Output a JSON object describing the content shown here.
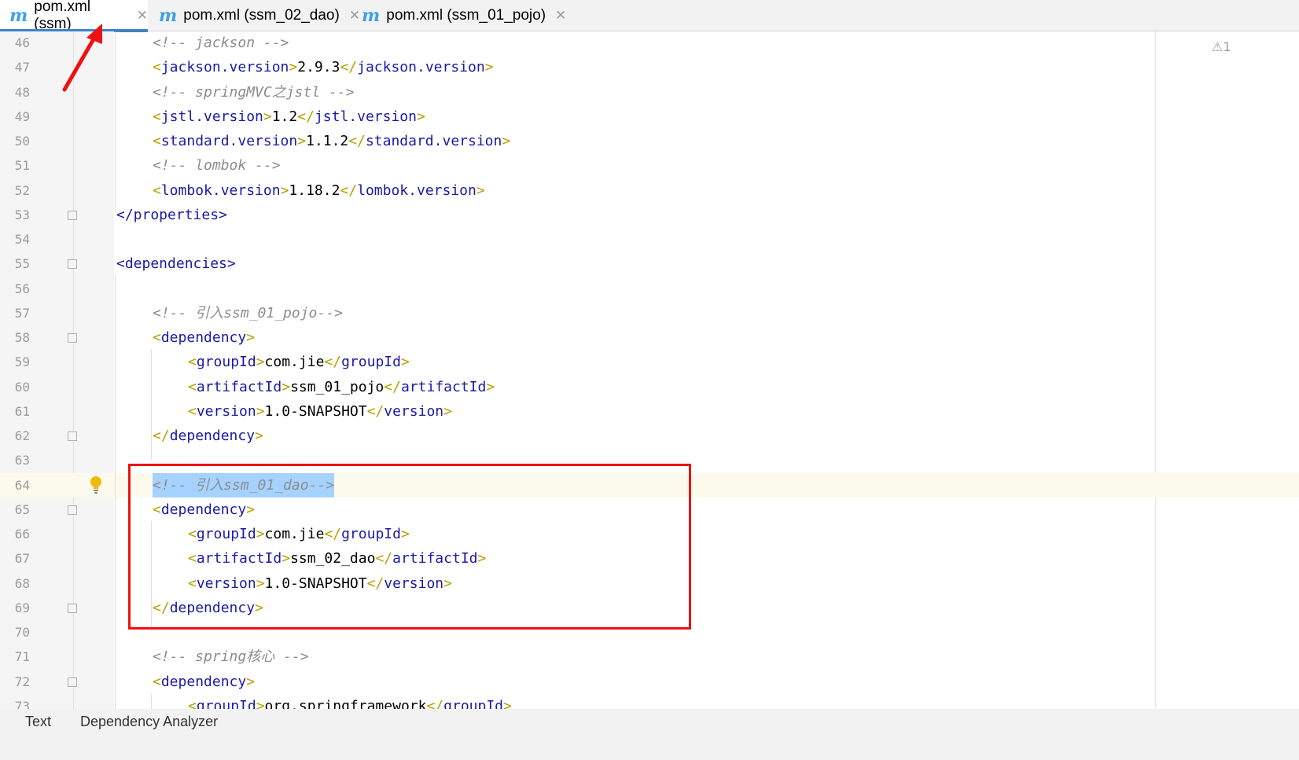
{
  "tabs": [
    {
      "label": "pom.xml (ssm)",
      "icon": "maven-m-icon",
      "active": true
    },
    {
      "label": "pom.xml (ssm_02_dao)",
      "icon": "maven-m-icon",
      "active": false
    },
    {
      "label": "pom.xml (ssm_01_pojo)",
      "icon": "maven-m-icon",
      "active": false
    }
  ],
  "tab_icon_glyph": "m",
  "tab_close_glyph": "✕",
  "warning_indicator": "⚠1",
  "bottom_tabs": [
    "Text",
    "Dependency Analyzer"
  ],
  "lines": [
    {
      "n": "46",
      "indent": 2,
      "parts": [
        [
          "cm",
          "<!-- jackson -->"
        ]
      ]
    },
    {
      "n": "47",
      "indent": 2,
      "parts": [
        [
          "br",
          "<"
        ],
        [
          "tg",
          "jackson.version"
        ],
        [
          "br",
          ">"
        ],
        [
          "tx",
          "2.9.3"
        ],
        [
          "br",
          "</"
        ],
        [
          "tg",
          "jackson.version"
        ],
        [
          "br",
          ">"
        ]
      ]
    },
    {
      "n": "48",
      "indent": 2,
      "parts": [
        [
          "cm",
          "<!-- springMVC之jstl -->"
        ]
      ]
    },
    {
      "n": "49",
      "indent": 2,
      "parts": [
        [
          "br",
          "<"
        ],
        [
          "tg",
          "jstl.version"
        ],
        [
          "br",
          ">"
        ],
        [
          "tx",
          "1.2"
        ],
        [
          "br",
          "</"
        ],
        [
          "tg",
          "jstl.version"
        ],
        [
          "br",
          ">"
        ]
      ]
    },
    {
      "n": "50",
      "indent": 2,
      "parts": [
        [
          "br",
          "<"
        ],
        [
          "tg",
          "standard.version"
        ],
        [
          "br",
          ">"
        ],
        [
          "tx",
          "1.1.2"
        ],
        [
          "br",
          "</"
        ],
        [
          "tg",
          "standard.version"
        ],
        [
          "br",
          ">"
        ]
      ]
    },
    {
      "n": "51",
      "indent": 2,
      "parts": [
        [
          "cm",
          "<!-- lombok -->"
        ]
      ]
    },
    {
      "n": "52",
      "indent": 2,
      "parts": [
        [
          "br",
          "<"
        ],
        [
          "tg",
          "lombok.version"
        ],
        [
          "br",
          ">"
        ],
        [
          "tx",
          "1.18.2"
        ],
        [
          "br",
          "</"
        ],
        [
          "tg",
          "lombok.version"
        ],
        [
          "br",
          ">"
        ]
      ]
    },
    {
      "n": "53",
      "indent": 1,
      "fold": true,
      "parts": [
        [
          "tg",
          "</properties>"
        ]
      ]
    },
    {
      "n": "54",
      "indent": 1,
      "parts": []
    },
    {
      "n": "55",
      "indent": 1,
      "fold": true,
      "parts": [
        [
          "tg",
          "<dependencies>"
        ]
      ]
    },
    {
      "n": "56",
      "indent": 1,
      "parts": []
    },
    {
      "n": "57",
      "indent": 2,
      "parts": [
        [
          "cm",
          "<!-- 引入ssm_01_pojo-->"
        ]
      ]
    },
    {
      "n": "58",
      "indent": 2,
      "fold": true,
      "parts": [
        [
          "br",
          "<"
        ],
        [
          "tg",
          "dependency"
        ],
        [
          "br",
          ">"
        ]
      ]
    },
    {
      "n": "59",
      "indent": 3,
      "parts": [
        [
          "br",
          "<"
        ],
        [
          "tg",
          "groupId"
        ],
        [
          "br",
          ">"
        ],
        [
          "tx",
          "com.jie"
        ],
        [
          "br",
          "</"
        ],
        [
          "tg",
          "groupId"
        ],
        [
          "br",
          ">"
        ]
      ]
    },
    {
      "n": "60",
      "indent": 3,
      "parts": [
        [
          "br",
          "<"
        ],
        [
          "tg",
          "artifactId"
        ],
        [
          "br",
          ">"
        ],
        [
          "tx",
          "ssm_01_pojo"
        ],
        [
          "br",
          "</"
        ],
        [
          "tg",
          "artifactId"
        ],
        [
          "br",
          ">"
        ]
      ]
    },
    {
      "n": "61",
      "indent": 3,
      "parts": [
        [
          "br",
          "<"
        ],
        [
          "tg",
          "version"
        ],
        [
          "br",
          ">"
        ],
        [
          "tx",
          "1.0-SNAPSHOT"
        ],
        [
          "br",
          "</"
        ],
        [
          "tg",
          "version"
        ],
        [
          "br",
          ">"
        ]
      ]
    },
    {
      "n": "62",
      "indent": 2,
      "fold": true,
      "parts": [
        [
          "br",
          "</"
        ],
        [
          "tg",
          "dependency"
        ],
        [
          "br",
          ">"
        ]
      ]
    },
    {
      "n": "63",
      "indent": 1,
      "parts": []
    },
    {
      "n": "64",
      "indent": 2,
      "caret": true,
      "bulb": true,
      "selected": true,
      "parts": [
        [
          "cm",
          "<!-- 引入ssm_01_dao-->"
        ]
      ]
    },
    {
      "n": "65",
      "indent": 2,
      "fold": true,
      "parts": [
        [
          "br",
          "<"
        ],
        [
          "tg",
          "dependency"
        ],
        [
          "br",
          ">"
        ]
      ]
    },
    {
      "n": "66",
      "indent": 3,
      "parts": [
        [
          "br",
          "<"
        ],
        [
          "tg",
          "groupId"
        ],
        [
          "br",
          ">"
        ],
        [
          "tx",
          "com.jie"
        ],
        [
          "br",
          "</"
        ],
        [
          "tg",
          "groupId"
        ],
        [
          "br",
          ">"
        ]
      ]
    },
    {
      "n": "67",
      "indent": 3,
      "parts": [
        [
          "br",
          "<"
        ],
        [
          "tg",
          "artifactId"
        ],
        [
          "br",
          ">"
        ],
        [
          "tx",
          "ssm_02_dao"
        ],
        [
          "br",
          "</"
        ],
        [
          "tg",
          "artifactId"
        ],
        [
          "br",
          ">"
        ]
      ]
    },
    {
      "n": "68",
      "indent": 3,
      "parts": [
        [
          "br",
          "<"
        ],
        [
          "tg",
          "version"
        ],
        [
          "br",
          ">"
        ],
        [
          "tx",
          "1.0-SNAPSHOT"
        ],
        [
          "br",
          "</"
        ],
        [
          "tg",
          "version"
        ],
        [
          "br",
          ">"
        ]
      ]
    },
    {
      "n": "69",
      "indent": 2,
      "fold": true,
      "parts": [
        [
          "br",
          "</"
        ],
        [
          "tg",
          "dependency"
        ],
        [
          "br",
          ">"
        ]
      ]
    },
    {
      "n": "70",
      "indent": 1,
      "parts": []
    },
    {
      "n": "71",
      "indent": 2,
      "parts": [
        [
          "cm",
          "<!-- spring核心 -->"
        ]
      ]
    },
    {
      "n": "72",
      "indent": 2,
      "fold": true,
      "parts": [
        [
          "br",
          "<"
        ],
        [
          "tg",
          "dependency"
        ],
        [
          "br",
          ">"
        ]
      ]
    },
    {
      "n": "73",
      "indent": 3,
      "parts": [
        [
          "br",
          "<"
        ],
        [
          "tg",
          "groupId"
        ],
        [
          "br",
          ">"
        ],
        [
          "tx",
          "org.springframework"
        ],
        [
          "br",
          "</"
        ],
        [
          "tg",
          "groupId"
        ],
        [
          "br",
          ">"
        ]
      ]
    }
  ],
  "colors": {
    "tag": "#1a1aa6",
    "bracket": "#b5a100",
    "comment": "#8c8c8c",
    "selection": "#a6d2ff",
    "highlight_box": "#ee1111",
    "tab_underline": "#4083c9"
  }
}
